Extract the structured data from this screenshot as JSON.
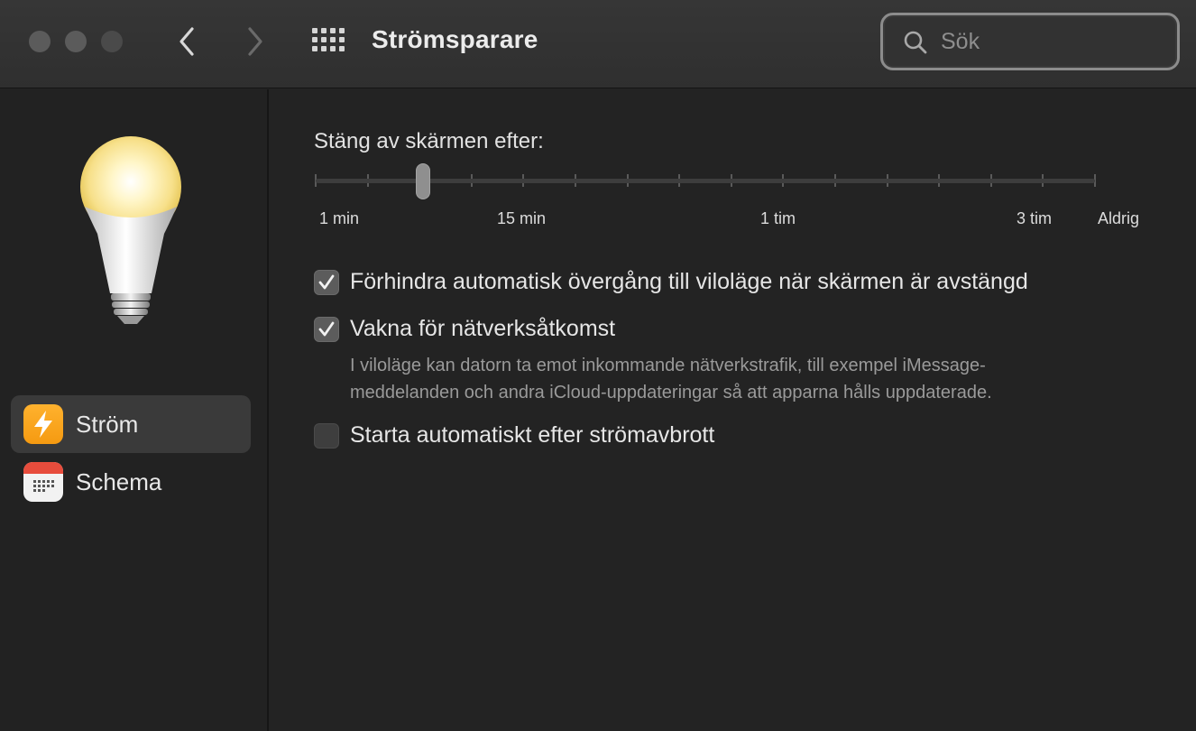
{
  "window": {
    "title": "Strömsparare",
    "search_placeholder": "Sök"
  },
  "sidebar": {
    "items": [
      {
        "label": "Ström",
        "icon": "lightning-bolt-icon",
        "active": true,
        "accent": "#f5a623"
      },
      {
        "label": "Schema",
        "icon": "calendar-icon",
        "active": false,
        "accent": "#e74c3c"
      }
    ]
  },
  "display_sleep": {
    "title": "Stäng av skärmen efter:",
    "tick_labels": [
      "1 min",
      "15 min",
      "1 tim",
      "3 tim",
      "Aldrig"
    ],
    "tick_count": 16,
    "selected_tick_index": 2
  },
  "options": [
    {
      "label": "Förhindra automatisk övergång till viloläge när skärmen är avstängd",
      "checked": true
    },
    {
      "label": "Vakna för nätverksåtkomst",
      "checked": true
    },
    {
      "label": "Starta automatiskt efter strömavbrott",
      "checked": false
    }
  ],
  "network_note": {
    "line1": "I viloläge kan datorn ta emot inkommande nätverkstrafik, till exempel iMessage-",
    "line2": "meddelanden och andra iCloud-uppdateringar så att apparna hålls uppdaterade."
  }
}
